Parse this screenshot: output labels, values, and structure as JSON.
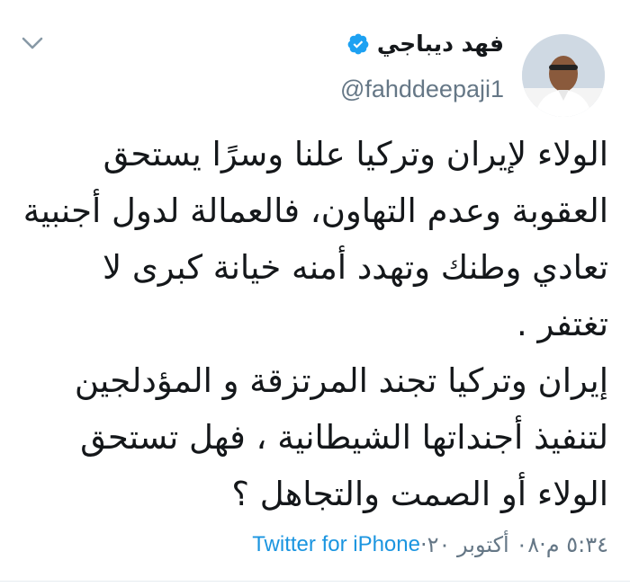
{
  "author": {
    "name": "فهد ديباجي",
    "handle": "@fahddeepaji1",
    "verified": true
  },
  "tweet": {
    "text": "الولاء لإيران وتركيا علنا وسرًا يستحق\nالعقوبة وعدم التهاون، فالعمالة لدول أجنبية\nتعادي وطنك وتهدد أمنه خيانة كبرى لا\nتغتفر .\nإيران وتركيا تجند المرتزقة و المؤدلجين\nلتنفيذ أجنداتها الشيطانية ، فهل تستحق\nالولاء  أو الصمت والتجاهل ؟",
    "time": "٥:٣٤ م",
    "separator": " · ",
    "date": "٠٨ أكتوبر ٢٠",
    "source": "Twitter for iPhone"
  },
  "icons": {
    "verified": "verified-badge-icon",
    "menu": "chevron-down-icon"
  },
  "colors": {
    "accent": "#1da1f2",
    "link": "#1b95e0",
    "secondary": "#657786",
    "text": "#14171a"
  }
}
